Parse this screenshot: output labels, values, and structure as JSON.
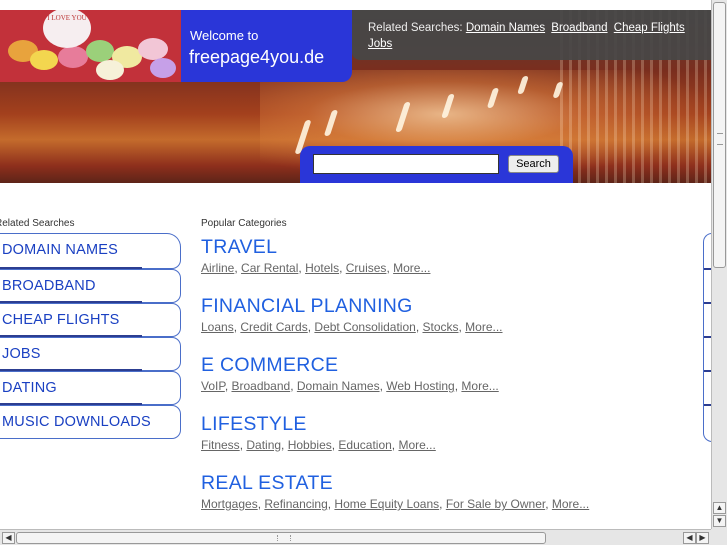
{
  "header": {
    "welcome_line1": "Welcome to",
    "welcome_line2": "freepage4you.de",
    "candy_text": "I LOVE YOU",
    "related_label": "Related Searches:",
    "related_links": [
      "Domain Names",
      "Broadband",
      "Cheap Flights",
      "Jobs"
    ],
    "search_button": "Search",
    "search_value": ""
  },
  "left": {
    "title": "Related Searches",
    "items": [
      "DOMAIN NAMES",
      "BROADBAND",
      "CHEAP FLIGHTS",
      "JOBS",
      "DATING",
      "MUSIC DOWNLOADS"
    ]
  },
  "center": {
    "title": "Popular Categories",
    "categories": [
      {
        "name": "TRAVEL",
        "links": [
          "Airline",
          "Car Rental",
          "Hotels",
          "Cruises"
        ],
        "more": "More..."
      },
      {
        "name": "FINANCIAL PLANNING",
        "links": [
          "Loans",
          "Credit Cards",
          "Debt Consolidation",
          "Stocks"
        ],
        "more": "More..."
      },
      {
        "name": "E COMMERCE",
        "links": [
          "VoIP",
          "Broadband",
          "Domain Names",
          "Web Hosting"
        ],
        "more": "More..."
      },
      {
        "name": "LIFESTYLE",
        "links": [
          "Fitness",
          "Dating",
          "Hobbies",
          "Education"
        ],
        "more": "More..."
      },
      {
        "name": "REAL ESTATE",
        "links": [
          "Mortgages",
          "Refinancing",
          "Home Equity Loans",
          "For Sale by Owner"
        ],
        "more": "More..."
      }
    ]
  },
  "colors": {
    "accent_blue": "#2a36d8",
    "link_heading": "#2060e0",
    "nav_text": "#1a40c2"
  },
  "icons": {
    "scroll_up": "arrow-up-icon",
    "scroll_down": "arrow-down-icon",
    "scroll_left": "arrow-left-icon",
    "scroll_right": "arrow-right-icon"
  }
}
